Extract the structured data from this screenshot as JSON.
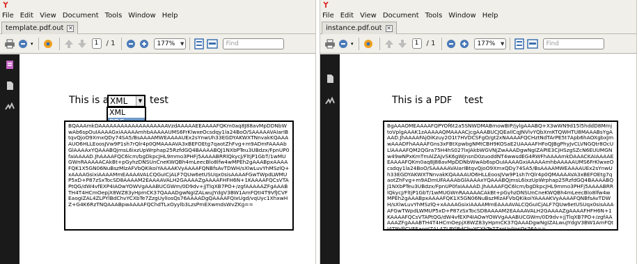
{
  "menu": [
    "File",
    "Edit",
    "View",
    "Document",
    "Tools",
    "Window",
    "Help"
  ],
  "toolbar": {
    "page_current": "1",
    "page_total": "/ 1",
    "zoom": "177%",
    "find_placeholder": "Find"
  },
  "left_window": {
    "tab_label": "template.pdf.out",
    "sentence_prefix": "This is a",
    "sentence_suffix": "test",
    "combo_value": "XML",
    "dropdown_options": [
      "XML",
      "PDF"
    ],
    "dropdown_selected": "PDF",
    "field_text": "BQAAAmkDAAAAAAAAAAAAAAAAAAAVzdAAAAAEEAAAAFQKm0aq8J88avMpDDNbWwAb6spOuIAAAAGxiAAAAAmhbAAAAAUMS6FrKlwxeOcsdqy1la24BoO/SAAAAAVAIarIBtqvQjoO9XmxQDy74SA5/BsAAAAMWEAAAAUEx2sYnwUh33EGDYAKWXTNnvakKQAAAAUO6HLLEoosJVw9P1sh7rQlr4p0QMAAAAVA3xBEFOEtg7qaotZhFvg+m9ADmFAAAAbGlAAAAxYQAAABQjmsL6ixzUpWrphap25RzfdGQ4BAAAABQJ1NXbPTeu3UBdzx/FpnUP0faIAAAAD.JhAAAAFQC6lcm/bgDkpcJHL9mmo3PHFj5AAAABRRlQkycJ/FltjP1GbT/1wMUGWnRAAAAACAkBt+pGyhzDNSUnCneKWQBh4mLeecBlo8lfw4wMPEh2gAAABpxAAAAFQK1X5GN06NuBszMlzAFVbQKikoiYAAAAKVyAAAAFQNBfsAvTDWH/sXlwLuvYhMSzlQ+xAAAAGsixiAAAAMmEAAAAVALCQGuICjALF7QUw6etUSUqx0sisAAAAFGwTWpdLWMUP5xD+P87zSxTocSD8AAAAM2EAAAAVALH2GAAAAZgAAAAFHFH6N+1KAAAAFQCsVTAPtQG/dW4vfEXP4IAOwYOWVgAAABUCGWm/0D9dv+jjTlqXB7PO+/zgfAAAAAZFgAAABTH4T4HCmOepjX8WZ83yHpmCK37QAAADgwNgIZALwuJYdgV3BW1AmFQtI4T9VfJCVFEaogIZAL4ZLPYlBdChvYCXbTe7ZzgUylIosQs76AAAADgQAAAAFQIxUgd/vqUyc1XhxwHZ+G4K6RzTNQAAABpwAAAAFQChdTLxOyylb3LzsPmEXwmdsWvZKg=="
  },
  "right_window": {
    "tab_label": "instance.pdf.out",
    "sentence_prefix": "This is a",
    "sentence_value": "PDF",
    "sentence_suffix": "test",
    "field_text": "BgAAAOMEAAAAFQPYOf6t2a5SNWDMABmowBIP/jylgAAABQ+X3wWN9d15l5hddD8MmjtoVplgAAAK1zAAAAAQMAAAACjcgAAABUCJQEaIlCqJNVlvYQbXmKTQWHTU8MAAABsYgAAAD.JhAAAAFAjOiKzuy2O1t7HVDCSFgO/gt2xNAAAAFQCHztNdTArPE5t7Apb6hAOXgbxJmwAAADFhAAAAFGns3xFBtXpwbgNMtCBH9KOSaE2UAAAAFHFoQJBgPhyJvCLVNGQtr8OcULlAAAAFQM2QGra75H4hS027lxJAkbWGVNjZwAAADgwNgIZAPIE3CjHSzgSZcN6EUUMGNw49wNPxKmTmAlZAJvSK6gWjnsnD0zuoddNT4wwsdEG4RWFhAAAAmkDAAACKAIAAAAEEAAAAFQKm0aq8J88avMpDDNbWwAb6spOuIAAAAGxiAAAAAmhbAAAAAUMS6FrKlwxeOcsdqy1la24BoO/SAAAAAVAIarIBtqvQjoO9XmxQDy74SA5/BsAAAAMWEAAAAUEx2sYnwUh33EGDYAKWXTNnvakKQAAAAUO6HLLEoosJVw9P1sh7rQlr4p0QMAAAAVA3xBEFOEtg7qaotZhFvg+m9ADmUFAAAAbGlAAAAxYQAAABQjmsL6ixzUpWrphap25RzfdGQ4BAAAABQJ1NXbPTeu3UBdzx/FpnUP0faIAAAAD.JhAAAAFQC6lcm/bgDkpcJHL9mmo3PHFj5AAAABRRlQkycJ/FltjP1GbT/1wMUGWnRAAAAACAkBt+pGyhzDNSUnCneKWQBh4mLeecBlo8lfw4wMPEh2gAAABpxAAAAFQK1X5GN06NuBszMlzAFVbQKikoiYAAAAKVyAAAAFQNBfsAvTDWH/sXlwLuvYhMSzlQ+xAAAAGsixiAAAAMmEAAAAVALCQGuICjALF7QUw6etUSUqx0sisAAAAFGwTWpdLWMUP5xD+P87zSxTocSD8AAAAM2EAAAAVALH2GAAAAZgAAAAFHFH6N+1KAAAAFQCsVTAPtQG/dW4vfEXP4IAOwYOWVgAAABUCGWm/0D9dv+jjTlqXB7PO+/zgfAAAAAZFgAAABTH4T4HCmOepjX8WZ83yHpmCK37QAAADgwNgIZALwuJYdgV3BW1AmFQtI4T9VfJCVFEaogIZAL4ZLPYlBdChvYCXbTe7ZzgUylIosQs76A=="
  },
  "colors": {
    "chrome": "#f0efe9",
    "sidebar": "#1a1a1a",
    "dropdown_highlight": "#6f99c9"
  }
}
